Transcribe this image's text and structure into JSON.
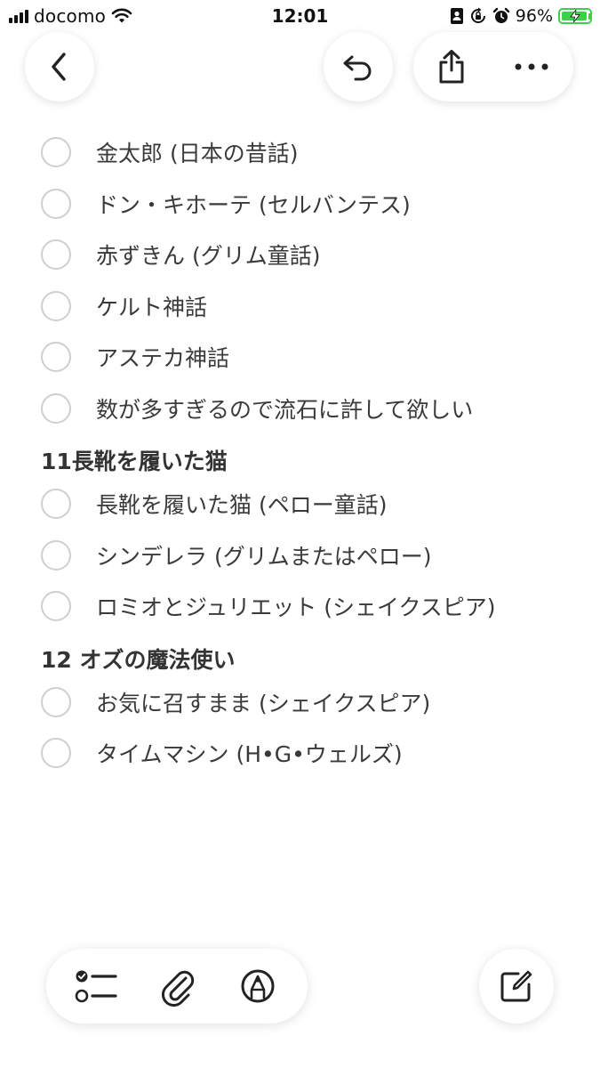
{
  "status_bar": {
    "carrier": "docomo",
    "time": "12:01",
    "battery_percent": "96%",
    "battery_color": "#3ccf4e"
  },
  "top_toolbar": {
    "back_icon": "chevron-left-icon",
    "undo_icon": "undo-icon",
    "share_icon": "share-icon",
    "more_icon": "ellipsis-icon"
  },
  "checklist": [
    {
      "type": "item",
      "text": "金太郎 (日本の昔話)",
      "checked": false
    },
    {
      "type": "item",
      "text": "ドン・キホーテ (セルバンテス)",
      "checked": false
    },
    {
      "type": "item",
      "text": "赤ずきん (グリム童話)",
      "checked": false
    },
    {
      "type": "item",
      "text": "ケルト神話",
      "checked": false
    },
    {
      "type": "item",
      "text": "アステカ神話",
      "checked": false
    },
    {
      "type": "item",
      "text": "数が多すぎるので流石に許して欲しい",
      "checked": false
    },
    {
      "type": "heading",
      "text": "11長靴を履いた猫"
    },
    {
      "type": "item",
      "text": "長靴を履いた猫 (ペロー童話)",
      "checked": false
    },
    {
      "type": "item",
      "text": "シンデレラ (グリムまたはペロー)",
      "checked": false
    },
    {
      "type": "item",
      "text": "ロミオとジュリエット (シェイクスピア)",
      "checked": false
    },
    {
      "type": "heading",
      "text": "12 オズの魔法使い"
    },
    {
      "type": "item",
      "text": "お気に召すまま (シェイクスピア)",
      "checked": false
    },
    {
      "type": "item",
      "text": "タイムマシン (H•G•ウェルズ)",
      "checked": false
    }
  ],
  "bottom_toolbar": {
    "checklist_icon": "checklist-icon",
    "attachment_icon": "paperclip-icon",
    "markup_icon": "pen-markup-icon",
    "compose_icon": "compose-icon"
  }
}
